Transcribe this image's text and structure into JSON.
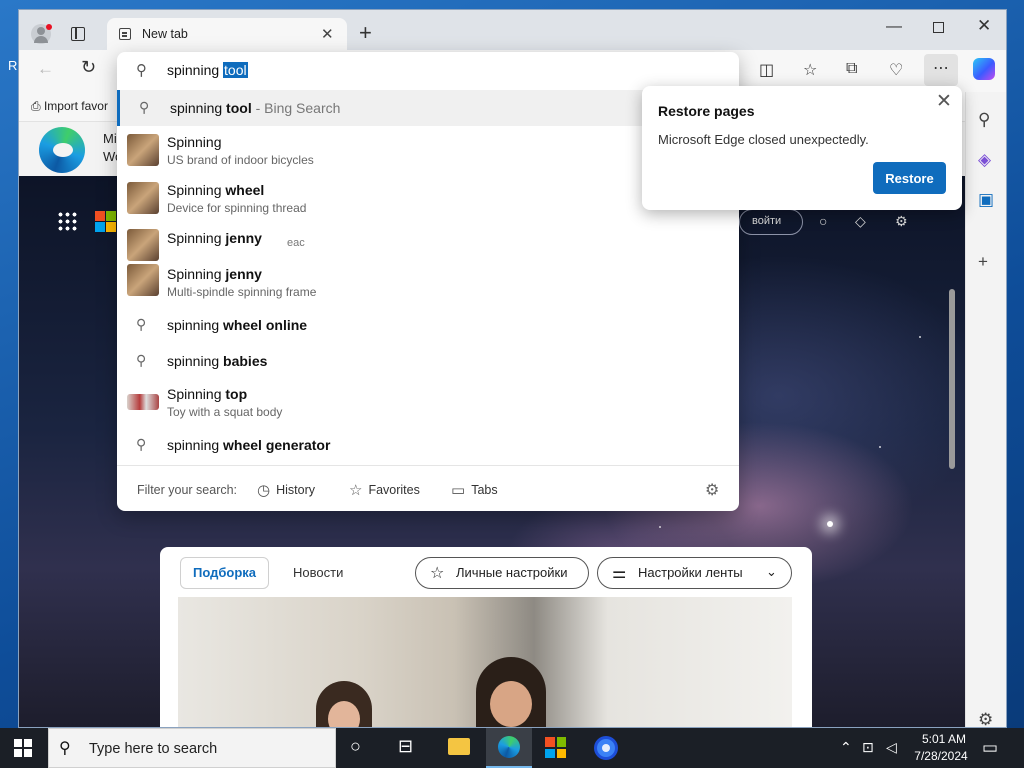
{
  "desktop": {
    "edge_letter": "R"
  },
  "browser": {
    "tab_title": "New tab",
    "tab_close": "✕",
    "new_tab": "+",
    "window_controls": {
      "minimize": "—",
      "close": "✕"
    },
    "nav": {
      "back": "←",
      "refresh": "↻"
    },
    "toolbar_icons": [
      "split-screen-icon",
      "favorites-icon",
      "collections-icon",
      "browser-essentials-icon",
      "more-icon",
      "copilot-icon"
    ],
    "favbar": {
      "import_label": "Import favor"
    }
  },
  "page": {
    "header_text_1": "Mi",
    "header_text_2": "Wo",
    "signin_label": "войти",
    "feed": {
      "tab_active": "Подборка",
      "tab_news": "Новости",
      "personal_settings": "Личные настройки",
      "feed_settings": "Настройки ленты"
    }
  },
  "omnibox": {
    "typed": "spinning ",
    "autocomplete": "tool",
    "suggestions": [
      {
        "type": "search",
        "main": "spinning ",
        "bold": "tool",
        "suffix": " - Bing Search",
        "selected": true
      },
      {
        "type": "entity",
        "main": "Spinning",
        "bold": "",
        "sub": "US brand of indoor bicycles"
      },
      {
        "type": "entity",
        "main": "Spinning ",
        "bold": "wheel",
        "sub": "Device for spinning thread"
      },
      {
        "type": "entity",
        "main": "Spinning ",
        "bold": "jenny",
        "sub": ""
      },
      {
        "type": "entity",
        "main": "Spinning ",
        "bold": "jenny",
        "sub": "Multi-spindle spinning frame"
      },
      {
        "type": "search",
        "main": "spinning ",
        "bold": "wheel online"
      },
      {
        "type": "search",
        "main": "spinning ",
        "bold": "babies"
      },
      {
        "type": "entity",
        "main": "Spinning ",
        "bold": "top",
        "sub": "Toy with a squat body"
      },
      {
        "type": "search",
        "main": "spinning ",
        "bold": "wheel generator"
      }
    ],
    "ghost_fragment": "eac",
    "footer": {
      "label": "Filter your search:",
      "history": "History",
      "favorites": "Favorites",
      "tabs": "Tabs"
    }
  },
  "restore_popup": {
    "title": "Restore pages",
    "message": "Microsoft Edge closed unexpectedly.",
    "button": "Restore",
    "close": "✕"
  },
  "taskbar": {
    "search_placeholder": "Type here to search",
    "time": "5:01 AM",
    "date": "7/28/2024"
  },
  "colors": {
    "accent": "#0f6cbd",
    "taskbar": "#1b1f26"
  }
}
